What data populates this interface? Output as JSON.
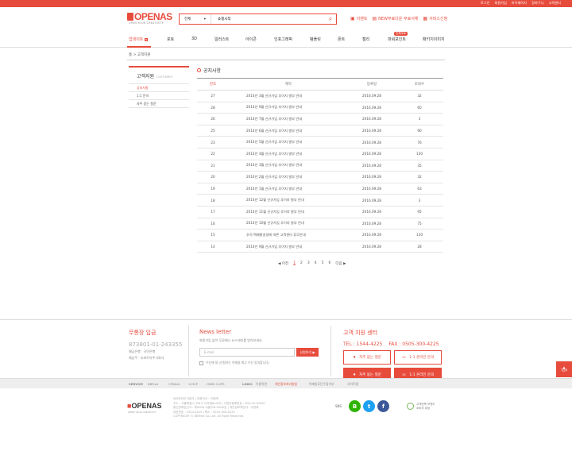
{
  "topbar": {
    "links": [
      "로그인",
      "회원가입",
      "마이페이지",
      "장바구니",
      "고객센터"
    ]
  },
  "logo": {
    "text": "OPENAS",
    "sub": "OPEN YOUR CREATIVITY"
  },
  "search": {
    "category": "전체",
    "value": "쇼핑시작"
  },
  "header_links": [
    {
      "icon": "gift-icon",
      "label": "이벤트"
    },
    {
      "icon": "download-icon",
      "label": "NEW무료다운 무료서체"
    },
    {
      "icon": "headset-icon",
      "label": "서비스신청"
    }
  ],
  "gnb": {
    "items": [
      "업데이트",
      "포토",
      "3D",
      "일러스트",
      "아이콘",
      "인포그래픽",
      "템플릿",
      "폰트",
      "캘리",
      "파워포인트",
      "패키지이미지"
    ],
    "badge": "전체무료"
  },
  "breadcrumb": "홈 > 고객지원",
  "side": {
    "title": "고객지원",
    "title_en": "CUSTOMER",
    "items": [
      "공지사항",
      "1:1 문의",
      "자주 묻는 질문"
    ]
  },
  "board": {
    "title": "공지사항",
    "headers": [
      "번호",
      "제목",
      "등록일",
      "조회수"
    ],
    "rows": [
      {
        "no": "27",
        "subject": "2014년 3월 신규가입 추이지 발부 안내",
        "date": "2016.09.28",
        "views": "32"
      },
      {
        "no": "28",
        "subject": "2014년 9월 신규가입 추이지 발부 안내",
        "date": "2016.09.28",
        "views": "60"
      },
      {
        "no": "26",
        "subject": "2014년 7월 신규가입 추이지 발부 안내",
        "date": "2016.09.28",
        "views": "3"
      },
      {
        "no": "25",
        "subject": "2014년 6월 신규가입 추이지 발부 안내",
        "date": "2016.09.28",
        "views": "90"
      },
      {
        "no": "23",
        "subject": "2014년 5월 신규가입 추이지 발부 안내",
        "date": "2016.09.28",
        "views": "76"
      },
      {
        "no": "22",
        "subject": "2014년 4월 신규가입 추이지 발부 안내",
        "date": "2016.09.28",
        "views": "130"
      },
      {
        "no": "21",
        "subject": "2014년 3월 신규가입 추이지 발부 안내",
        "date": "2016.09.28",
        "views": "35"
      },
      {
        "no": "20",
        "subject": "2014년 2월 신규가입 추이지 발부 안내",
        "date": "2016.09.28",
        "views": "32"
      },
      {
        "no": "19",
        "subject": "2014년 1월 신규가입 추이지 발부 안내",
        "date": "2016.09.28",
        "views": "63"
      },
      {
        "no": "18",
        "subject": "2014년 12월 신규가입 추이지 발부 안내",
        "date": "2016.09.28",
        "views": "3"
      },
      {
        "no": "17",
        "subject": "2014년 11월 신규가입 추이지 발부 안내",
        "date": "2016.09.28",
        "views": "95"
      },
      {
        "no": "16",
        "subject": "2014년 10월 신규가입 추이지 발부 안내",
        "date": "2016.09.28",
        "views": "75"
      },
      {
        "no": "15",
        "subject": "추석 택배발송일에 따른 고객센터 휴무안내",
        "date": "2016.09.28",
        "views": "130"
      },
      {
        "no": "14",
        "subject": "2014년 9월 신규가입 추이지 발부 안내",
        "date": "2016.09.28",
        "views": "28"
      }
    ]
  },
  "pager": {
    "prev": "◀ 이전",
    "pages": [
      "1",
      "2",
      "3",
      "4",
      "5",
      "6"
    ],
    "current": "1",
    "next": "다음 ▶"
  },
  "footer": {
    "bank": {
      "title": "무통장 입금",
      "account": "873801-01-243355",
      "bank_name": "예금은행 : 국민은행",
      "holder": "예금주 : 씨비트라주식회사"
    },
    "newsletter": {
      "title": "News letter",
      "desc": "회원가입 없이 무료배시 뉴스레터를 받아보세요.",
      "placeholder": "E-mail",
      "button": "신청하기 ▶",
      "agree": "수신에 대 (신청하는 이메일 최고 수신 동의합니다)"
    },
    "cs": {
      "title": "고객 지원 센터",
      "tel": "TEL : 1544-4225",
      "fax": "FAX : 0505-300-4225",
      "buttons": [
        "자주 묻는 질문",
        "1:1 온라인 문의",
        "자주 묻는 질문",
        "1:1 온라인 문의"
      ]
    }
  },
  "top_button": {
    "label": "TOP"
  },
  "services": {
    "groups": [
      {
        "label": "SERVICE",
        "items": [
          "BBFree",
          "CPWork",
          "123CP",
          "ONEK CLIPS"
        ]
      },
      {
        "label": "LINKS",
        "items": [
          "이용약관",
          "개인정보처리방침",
          "이메일무단수집거부",
          "사이트맵"
        ]
      }
    ]
  },
  "bottom": {
    "logo": "OPENAS",
    "logo_sub": "OPEN YOUR CREATIVITY",
    "info": [
      "씨비트라주식회사 | 대표이사 : 이영래",
      "주소 : 서울특별시 구로구 디지털로 000 | 사업자등록번호 : 000-00-00000",
      "통신판매업신고 : 제0000-서울구로-0000호 | 개인정보책임자 : 이영래",
      "대표번호 : 1544-4225 | 팩스 : 0505-300-4225",
      "COPYRIGHT © BBFree Co.,Ltd. All Right Reserved."
    ],
    "sns_label": "SNS",
    "sns": [
      {
        "icon": "blog-icon",
        "glyph": "B",
        "color": "#2db400"
      },
      {
        "icon": "twitter-icon",
        "glyph": "t",
        "color": "#1da1f2"
      },
      {
        "icon": "facebook-icon",
        "glyph": "f",
        "color": "#3b5998"
      }
    ],
    "award": [
      "고객만족 브랜드",
      "소비자 대상"
    ]
  },
  "colors": {
    "accent": "#e74b3c"
  }
}
